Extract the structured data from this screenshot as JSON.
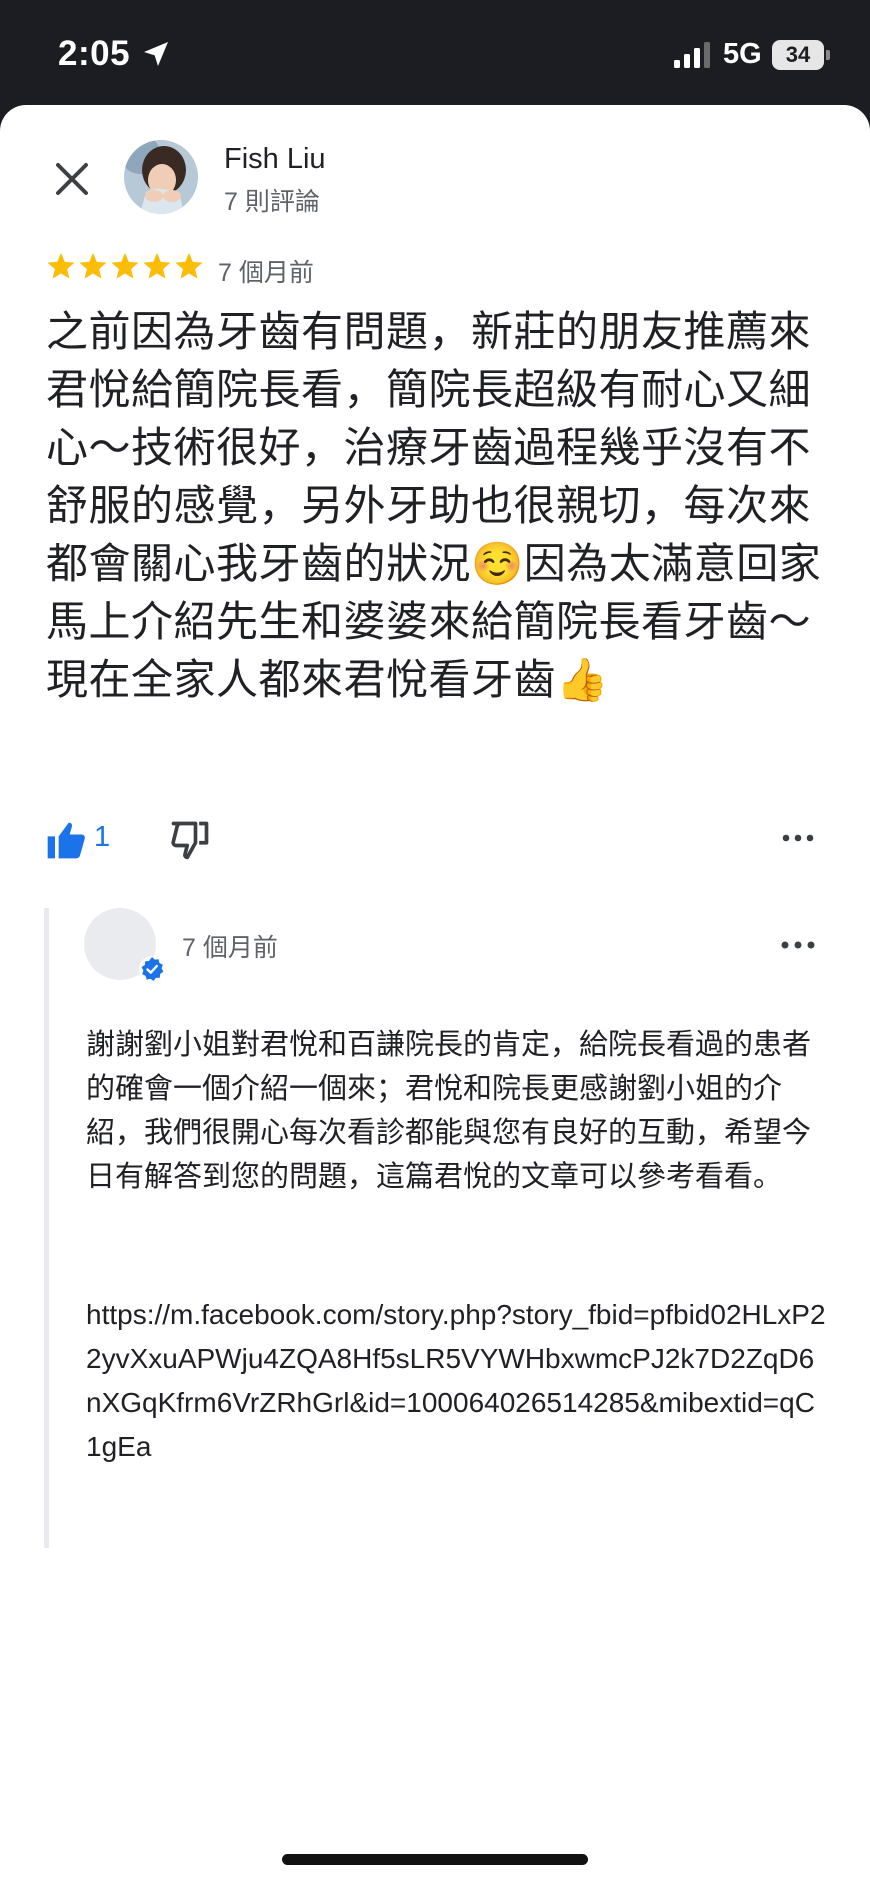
{
  "status_bar": {
    "time": "2:05",
    "network": "5G",
    "battery": "34"
  },
  "review": {
    "reviewer_name": "Fish Liu",
    "review_count": "7 則評論",
    "rating": 5,
    "date": "7 個月前",
    "text": "之前因為牙齒有問題，新莊的朋友推薦來君悅給簡院長看，簡院長超級有耐心又細心～技術很好，治療牙齒過程幾乎沒有不舒服的感覺，另外牙助也很親切，每次來都會關心我牙齒的狀況☺️因為太滿意回家馬上介紹先生和婆婆來給簡院長看牙齒～現在全家人都來君悅看牙齒👍",
    "like_count": "1"
  },
  "owner_reply": {
    "date": "7 個月前",
    "text": "謝謝劉小姐對君悅和百謙院長的肯定，給院長看過的患者的確會一個介紹一個來；君悅和院長更感謝劉小姐的介紹，我們很開心每次看診都能與您有良好的互動，希望今日有解答到您的問題，這篇君悅的文章可以參考看看。",
    "link": "https://m.facebook.com/story.php?story_fbid=pfbid02HLxP22yvXxuAPWju4ZQA8Hf5sLR5VYWHbxwmcPJ2k7D2ZqD6nXGqKfrm6VrZRhGrl&id=100064026514285&mibextid=qC1gEa"
  },
  "colors": {
    "star": "#fbbc04",
    "like_active": "#1a73e8",
    "verified": "#1a73e8",
    "status_bar_bg": "#1c1d22"
  },
  "icons": {
    "close": "close-icon",
    "like": "thumb-up-icon",
    "dislike": "thumb-down-icon",
    "more": "more-horizontal-icon",
    "verified": "verified-check-icon",
    "location": "location-arrow-icon",
    "signal": "signal-bars-icon",
    "battery": "battery-icon"
  }
}
